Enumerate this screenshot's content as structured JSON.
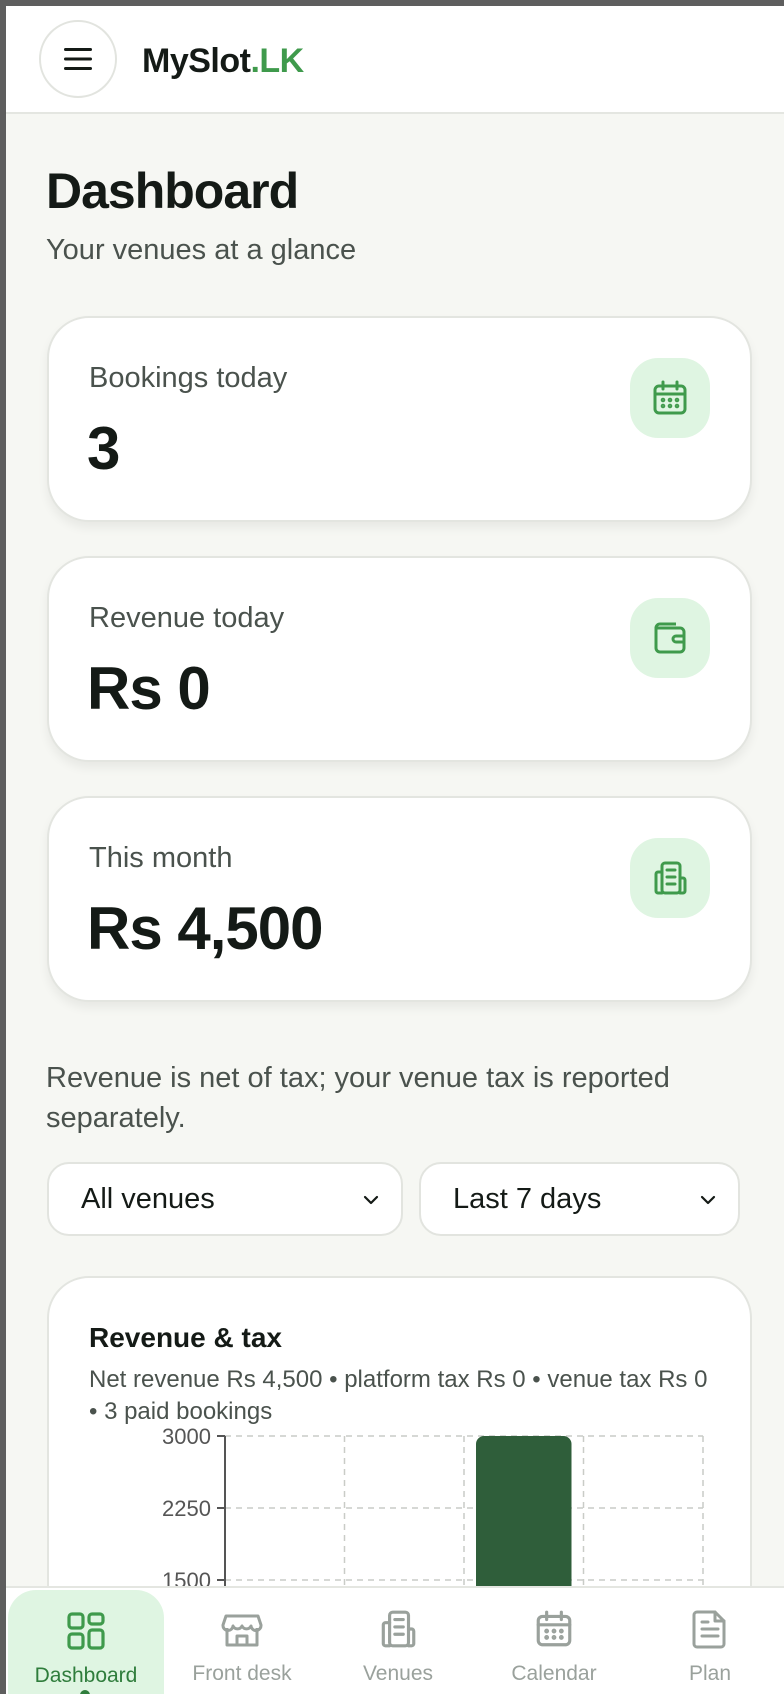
{
  "header": {
    "brand_main": "MySlot",
    "brand_tld": ".LK",
    "menu_icon": "hamburger-menu-icon"
  },
  "page": {
    "title": "Dashboard",
    "subtitle": "Your venues at a glance"
  },
  "stats": [
    {
      "label": "Bookings today",
      "value": "3",
      "icon": "calendar-icon"
    },
    {
      "label": "Revenue today",
      "value": "Rs 0",
      "icon": "wallet-icon"
    },
    {
      "label": "This month",
      "value": "Rs 4,500",
      "icon": "receipt-icon"
    }
  ],
  "note": "Revenue is net of tax; your venue tax is reported separately.",
  "filters": {
    "venue": {
      "selected": "All venues"
    },
    "period": {
      "selected": "Last 7 days"
    }
  },
  "chart_card": {
    "title": "Revenue & tax",
    "subtitle": "Net revenue Rs 4,500 • platform tax Rs 0 • venue tax Rs 0 • 3 paid bookings"
  },
  "chart_data": {
    "type": "bar",
    "title": "Revenue & tax",
    "y_ticks": [
      "3000",
      "2250",
      "1500"
    ],
    "y_tick_values": [
      3000,
      2250,
      1500
    ],
    "ylim": [
      0,
      3000
    ],
    "grid": true,
    "series": [
      {
        "values": [
          0,
          0,
          3000,
          0
        ],
        "color": "#2f5e3a"
      }
    ]
  },
  "nav": [
    {
      "label": "Dashboard",
      "icon": "dashboard-grid-icon",
      "active": true
    },
    {
      "label": "Front desk",
      "icon": "storefront-icon",
      "active": false
    },
    {
      "label": "Venues",
      "icon": "building-icon",
      "active": false
    },
    {
      "label": "Calendar",
      "icon": "calendar-icon",
      "active": false
    },
    {
      "label": "Plan",
      "icon": "document-icon",
      "active": false
    }
  ],
  "colors": {
    "accent": "#3f9a4c",
    "accent_soft": "#dff5e2",
    "bar": "#2f5e3a",
    "background": "#f6f7f3"
  }
}
